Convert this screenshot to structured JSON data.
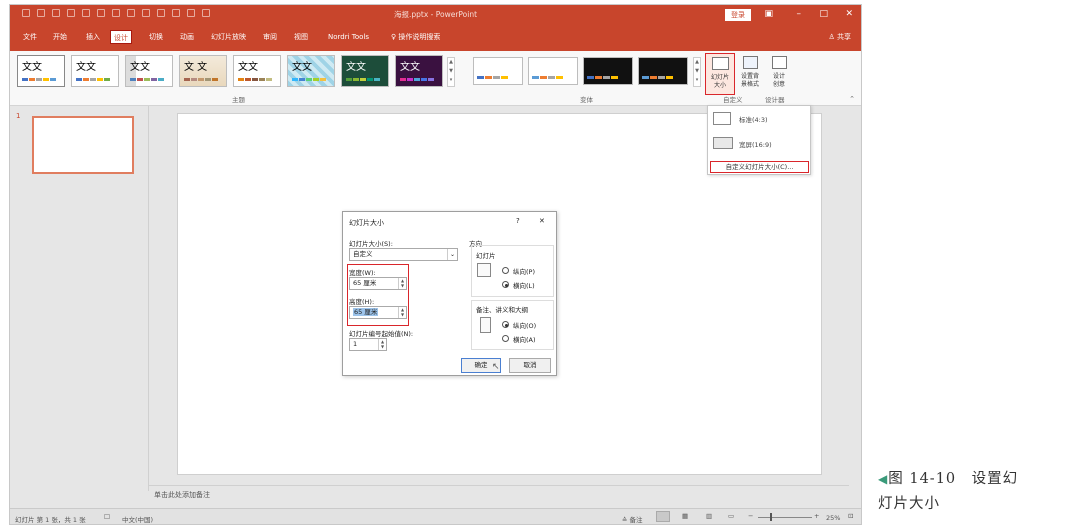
{
  "window": {
    "title": "海报.pptx - PowerPoint",
    "login_label": "登录",
    "share_label": "共享"
  },
  "tabs": [
    {
      "label": "文件"
    },
    {
      "label": "开始"
    },
    {
      "label": "插入"
    },
    {
      "label": "设计"
    },
    {
      "label": "切换"
    },
    {
      "label": "动画"
    },
    {
      "label": "幻灯片放映"
    },
    {
      "label": "审阅"
    },
    {
      "label": "视图"
    },
    {
      "label": "Nordri Tools"
    },
    {
      "label": "操作说明搜索"
    }
  ],
  "active_tab": "设计",
  "ribbon": {
    "theme_text": "文文",
    "theme_text_alt": "文 文",
    "themes_group_label": "主题",
    "variants_group_label": "变体",
    "slide_size_label_1": "幻灯片",
    "slide_size_label_2": "大小",
    "bg_format_label_1": "设置背",
    "bg_format_label_2": "景格式",
    "designer_label_1": "设计",
    "designer_label_2": "创意",
    "custom_group_label": "自定义",
    "designer_group_label": "设计器"
  },
  "size_menu": {
    "standard": "标准(4:3)",
    "widescreen": "宽屏(16:9)",
    "custom": "自定义幻灯片大小(C)..."
  },
  "dialog": {
    "title": "幻灯片大小",
    "help": "?",
    "close": "✕",
    "size_label": "幻灯片大小(S):",
    "size_value": "自定义",
    "width_label": "宽度(W):",
    "width_value": "65 厘米",
    "height_label": "高度(H):",
    "height_value": "65 厘米",
    "start_label": "幻灯片编号起始值(N):",
    "start_value": "1",
    "orientation_label": "方向",
    "slides_label": "幻灯片",
    "portrait_label": "纵向(P)",
    "landscape_label": "横向(L)",
    "notes_label": "备注、讲义和大纲",
    "notes_portrait_label": "纵向(O)",
    "notes_landscape_label": "横向(A)",
    "ok_label": "确定",
    "cancel_label": "取消"
  },
  "slides": {
    "number": "1",
    "notes_placeholder": "单击此处添加备注"
  },
  "status": {
    "slide_info": "幻灯片 第 1 张，共 1 张",
    "language": "中文(中国)",
    "notes_label": "备注",
    "zoom": "25%"
  },
  "caption": {
    "line1": "图 14-10　设置幻",
    "line2": "灯片大小"
  },
  "colors": {
    "accent": "#c8452c",
    "highlight": "#d9262b"
  }
}
